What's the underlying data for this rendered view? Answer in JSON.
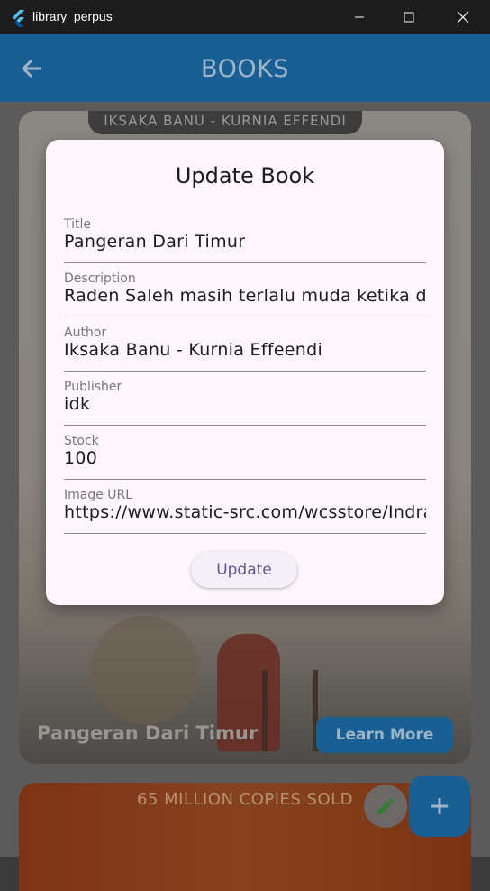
{
  "window": {
    "title": "library_perpus"
  },
  "appbar": {
    "title": "BOOKS"
  },
  "card": {
    "banner": "IKSAKA BANU - KURNIA EFFENDI",
    "book_title": "Pangeran Dari Timur",
    "learn_more": "Learn More"
  },
  "card2": {
    "banner": "65 MILLION COPIES SOLD"
  },
  "dialog": {
    "title": "Update Book",
    "fields": [
      {
        "label": "Title",
        "value": "Pangeran Dari Timur"
      },
      {
        "label": "Description",
        "value": "Raden Saleh masih terlalu muda ketika dipi"
      },
      {
        "label": "Author",
        "value": "Iksaka Banu - Kurnia Effeendi"
      },
      {
        "label": "Publisher",
        "value": "idk"
      },
      {
        "label": "Stock",
        "value": "100"
      },
      {
        "label": "Image URL",
        "value": "https://www.static-src.com/wcsstore/Indrap"
      }
    ],
    "update_label": "Update"
  },
  "fab": {
    "add_symbol": "+"
  },
  "colors": {
    "appbar": "#1a5f94",
    "dialog_bg": "#fdf6fd",
    "accent_text": "#65558f"
  }
}
